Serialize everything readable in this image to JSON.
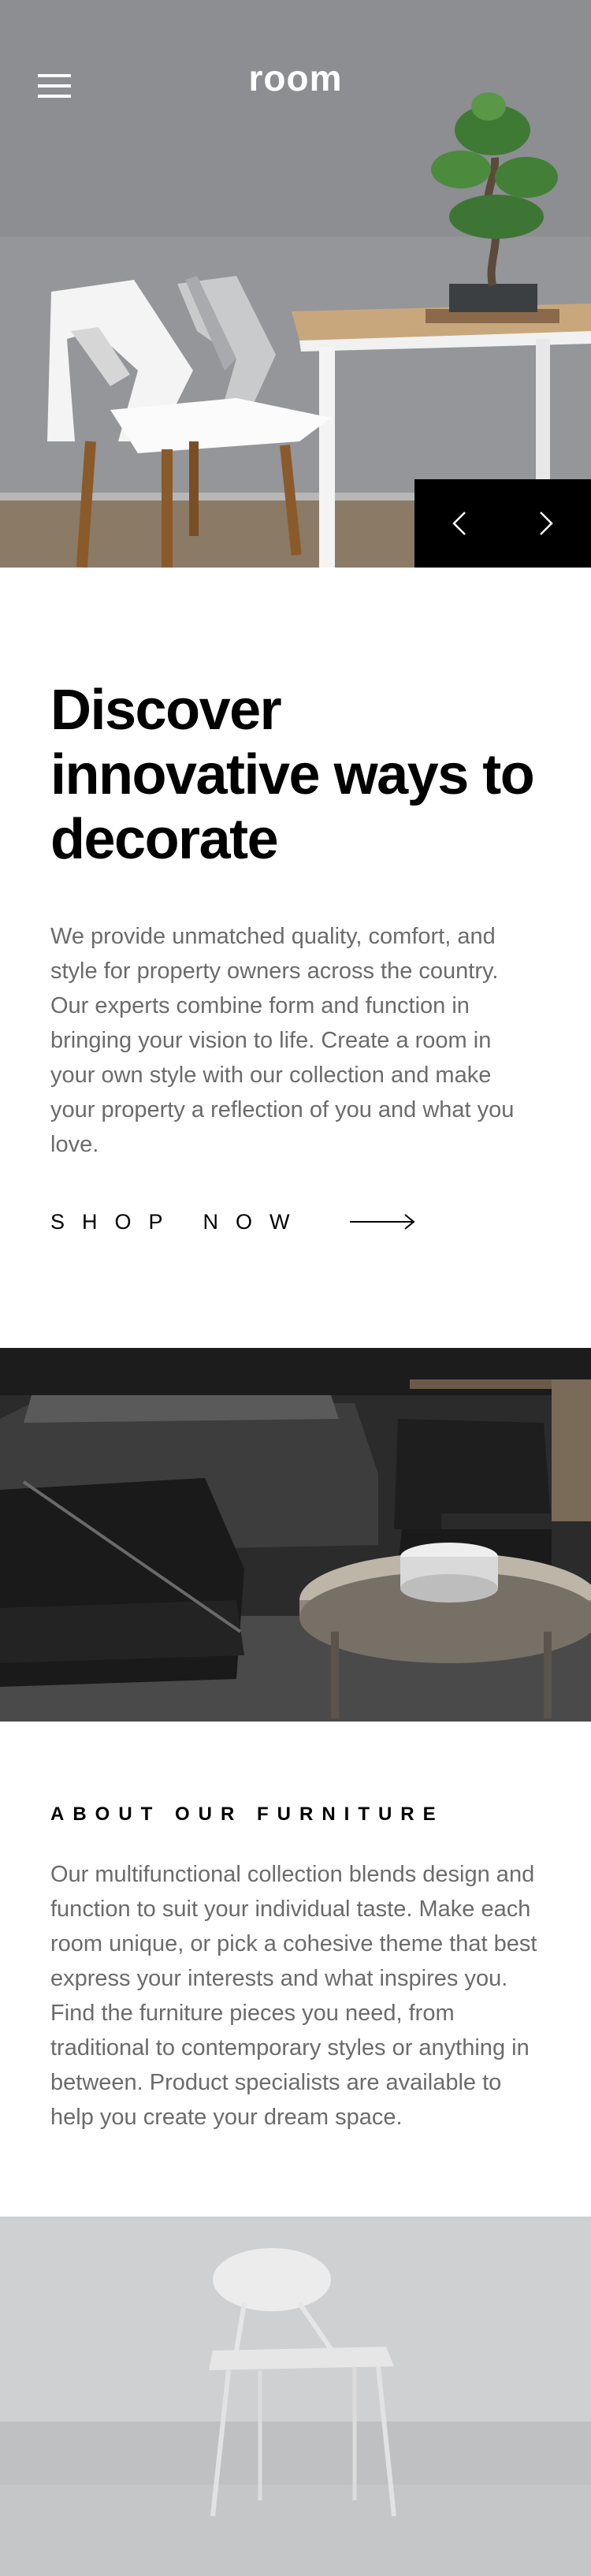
{
  "header": {
    "logo": "room",
    "menu_icon": "hamburger-menu-icon"
  },
  "hero": {
    "image_description_icon": "white-chairs-and-table-with-bonsai",
    "prev_icon": "chevron-left-icon",
    "next_icon": "chevron-right-icon"
  },
  "intro": {
    "title": "Discover innovative ways to decorate",
    "body": "We provide unmatched quality, comfort, and style for property owners across the country. Our experts combine form and function in bringing your vision to life. Create a room in your own style with our collection and make your property a reflection of you and what you love.",
    "cta_label": "SHOP NOW",
    "cta_icon": "arrow-right-icon"
  },
  "about": {
    "title": "ABOUT OUR FURNITURE",
    "body": "Our multifunctional collection blends design and function to suit your individual taste. Make each room unique, or pick a cohesive theme that best express your interests and what inspires you. Find the furniture pieces you need, from traditional to contemporary styles or anything in between. Product specialists are available to help you create your dream space."
  },
  "colors": {
    "text_primary": "#000000",
    "text_body": "#6b6b6b",
    "control_bg": "#000000",
    "page_bg": "#ffffff"
  }
}
